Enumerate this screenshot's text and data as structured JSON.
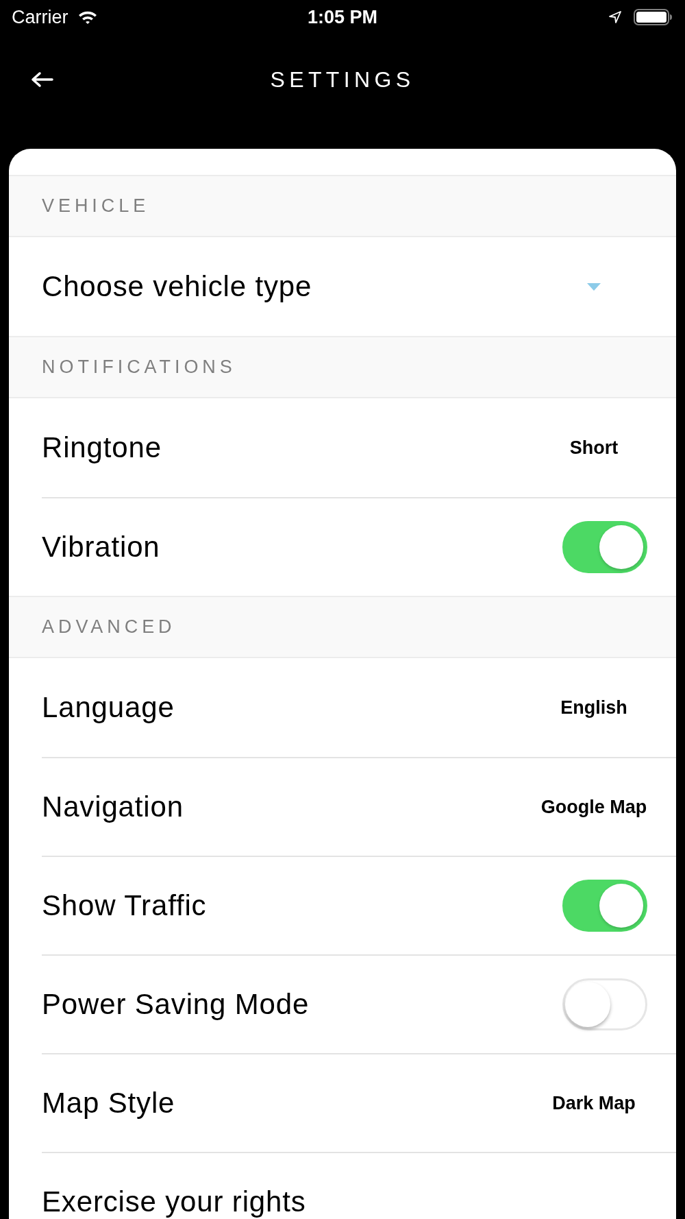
{
  "status_bar": {
    "carrier": "Carrier",
    "time": "1:05 PM"
  },
  "header": {
    "title": "SETTINGS"
  },
  "sections": [
    {
      "title": "VEHICLE",
      "items": [
        {
          "kind": "dropdown",
          "label": "Choose vehicle type"
        }
      ]
    },
    {
      "title": "NOTIFICATIONS",
      "items": [
        {
          "kind": "value",
          "label": "Ringtone",
          "value": "Short"
        },
        {
          "kind": "toggle",
          "label": "Vibration",
          "on": true
        }
      ]
    },
    {
      "title": "ADVANCED",
      "items": [
        {
          "kind": "value",
          "label": "Language",
          "value": "English"
        },
        {
          "kind": "value",
          "label": "Navigation",
          "value": "Google Map"
        },
        {
          "kind": "toggle",
          "label": "Show Traffic",
          "on": true
        },
        {
          "kind": "toggle",
          "label": "Power Saving Mode",
          "on": false
        },
        {
          "kind": "value",
          "label": "Map Style",
          "value": "Dark Map"
        },
        {
          "kind": "link",
          "label": "Exercise your rights"
        }
      ]
    }
  ]
}
